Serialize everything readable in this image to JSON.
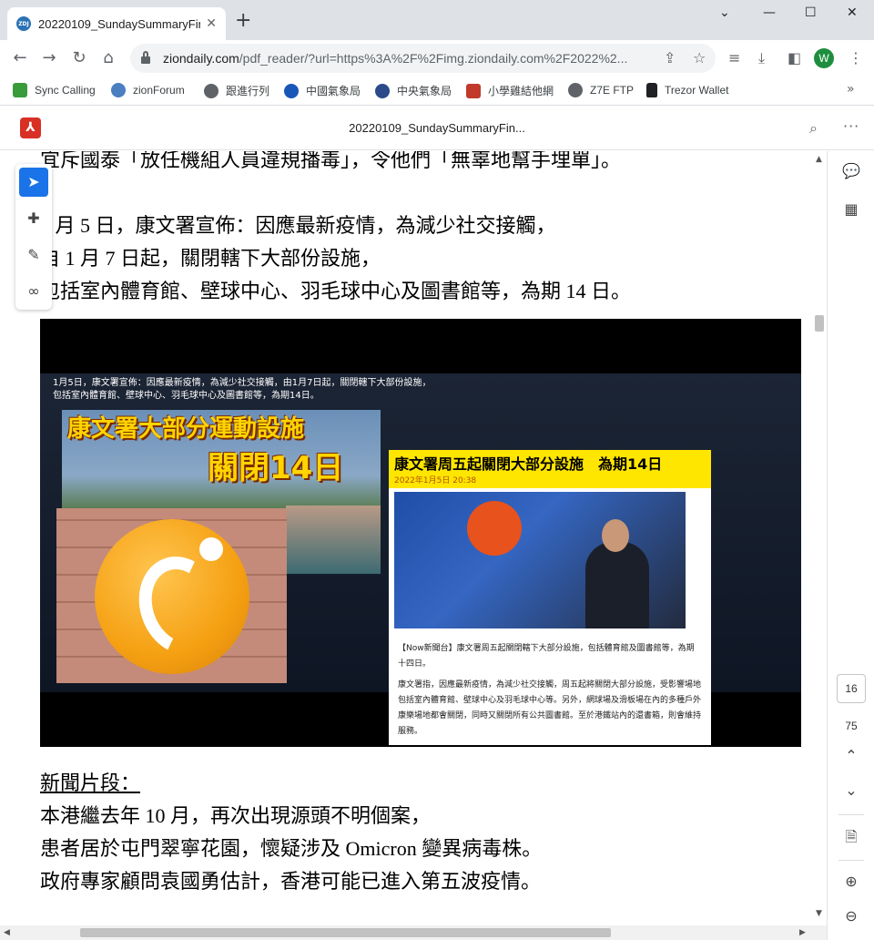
{
  "browser": {
    "tab_title": "20220109_SundaySummaryFin",
    "tab_favicon_text": "ZDJ",
    "url_host": "ziondaily.com",
    "url_path": "/pdf_reader/?url=https%3A%2F%2Fimg.ziondaily.com%2F2022%2...",
    "profile_initial": "W"
  },
  "bookmarks": [
    {
      "label": "Sync Calling",
      "color": "#3a9b3a"
    },
    {
      "label": "zionForum",
      "color": "#4a7fc0"
    },
    {
      "label": "跟進行列",
      "color": "#5f6368"
    },
    {
      "label": "中國氣象局",
      "color": "#1a56b8"
    },
    {
      "label": "中央氣象局",
      "color": "#2c4a8a"
    },
    {
      "label": "小學雞結他網",
      "color": "#c0392b"
    },
    {
      "label": "Z7E FTP",
      "color": "#5f6368"
    },
    {
      "label": "Trezor Wallet",
      "color": "#202124"
    }
  ],
  "pdf": {
    "title": "20220109_SundaySummaryFin...",
    "current_page": "16",
    "total_pages": "75"
  },
  "document": {
    "line_top": "宜斥國泰「放任機組人員違規播毒」，令他們「無辜地幫手埋單」。",
    "para1": [
      "1 月 5 日，康文署宣佈：因應最新疫情，為減少社交接觸，",
      "自 1 月 7 日起，關閉轄下大部份設施，",
      "包括室內體育館、壁球中心、羽毛球中心及圖書館等，為期 14 日。"
    ],
    "news_heading": "新聞片段：",
    "para2": [
      "本港繼去年 10 月，再次出現源頭不明個案，",
      "患者居於屯門翠寧花園，懷疑涉及 Omicron 變異病毒株。",
      "政府專家顧問袁國勇估計，香港可能已進入第五波疫情。"
    ]
  },
  "video": {
    "caption_line1": "1月5日，康文署宣佈：因應最新疫情，為減少社交接觸，由1月7日起，關閉轄下大部份設施，",
    "caption_line2": "包括室內體育館、壁球中心、羽毛球中心及圖書館等，為期14日。",
    "headline1": "康文署大部分運動設施",
    "headline2": "關閉14日",
    "news_title": "康文署周五起關閉大部分設施　為期14日",
    "news_date": "2022年1月5日 20:38",
    "news_para1": "【Now新聞台】康文署周五起關閉轄下大部分設施，包括體育館及圖書館等，為期十四日。",
    "news_para2": "康文署指，因應最新疫情，為減少社交接觸，周五起將關閉大部分設施，受影響場地包括室內體育館、壁球中心及羽毛球中心等。另外，網球場及滑板場在內的多種戶外康樂場地都會關閉，同時又關閉所有公共圖書館。至於港鐵站內的還書箱，則會維持服務。"
  }
}
